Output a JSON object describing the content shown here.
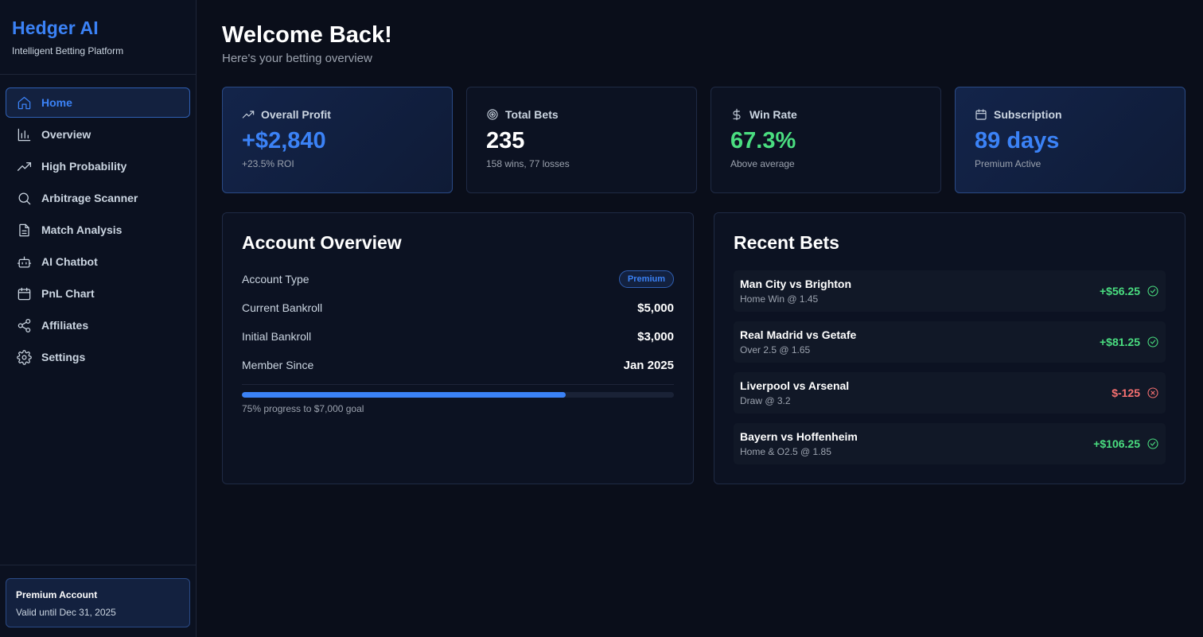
{
  "brand": {
    "title": "Hedger AI",
    "subtitle": "Intelligent Betting Platform"
  },
  "nav": [
    {
      "label": "Home",
      "icon": "home-icon",
      "active": true
    },
    {
      "label": "Overview",
      "icon": "bar-chart-icon"
    },
    {
      "label": "High Probability",
      "icon": "trending-up-icon"
    },
    {
      "label": "Arbitrage Scanner",
      "icon": "search-icon"
    },
    {
      "label": "Match Analysis",
      "icon": "document-icon"
    },
    {
      "label": "AI Chatbot",
      "icon": "bot-icon"
    },
    {
      "label": "PnL Chart",
      "icon": "calendar-icon"
    },
    {
      "label": "Affiliates",
      "icon": "share-icon"
    },
    {
      "label": "Settings",
      "icon": "gear-icon"
    }
  ],
  "sidebar_footer": {
    "title": "Premium Account",
    "valid": "Valid until Dec 31, 2025"
  },
  "header": {
    "title": "Welcome Back!",
    "subtitle": "Here's your betting overview"
  },
  "stats": [
    {
      "label": "Overall Profit",
      "value": "+$2,840",
      "sub": "+23.5% ROI",
      "icon": "trending-up-icon"
    },
    {
      "label": "Total Bets",
      "value": "235",
      "sub": "158 wins, 77 losses",
      "icon": "target-icon"
    },
    {
      "label": "Win Rate",
      "value": "67.3%",
      "sub": "Above average",
      "icon": "dollar-icon"
    },
    {
      "label": "Subscription",
      "value": "89 days",
      "sub": "Premium Active",
      "icon": "calendar-icon"
    }
  ],
  "account": {
    "title": "Account Overview",
    "rows": [
      {
        "label": "Account Type",
        "value": "Premium"
      },
      {
        "label": "Current Bankroll",
        "value": "$5,000"
      },
      {
        "label": "Initial Bankroll",
        "value": "$3,000"
      },
      {
        "label": "Member Since",
        "value": "Jan 2025"
      }
    ],
    "progress": 0.75,
    "progress_label": "75% progress to $7,000 goal"
  },
  "recent": {
    "title": "Recent Bets",
    "bets": [
      {
        "match": "Man City vs Brighton",
        "detail": "Home Win @ 1.45",
        "result": "+$56.25",
        "status": "win"
      },
      {
        "match": "Real Madrid vs Getafe",
        "detail": "Over 2.5 @ 1.65",
        "result": "+$81.25",
        "status": "win"
      },
      {
        "match": "Liverpool vs Arsenal",
        "detail": "Draw @ 3.2",
        "result": "$-125",
        "status": "loss"
      },
      {
        "match": "Bayern vs Hoffenheim",
        "detail": "Home & O2.5 @ 1.85",
        "result": "+$106.25",
        "status": "win"
      }
    ]
  },
  "colors": {
    "accent": "#3b82f6",
    "positive": "#4ade80",
    "negative": "#f87171",
    "background": "#0a0e1a"
  }
}
